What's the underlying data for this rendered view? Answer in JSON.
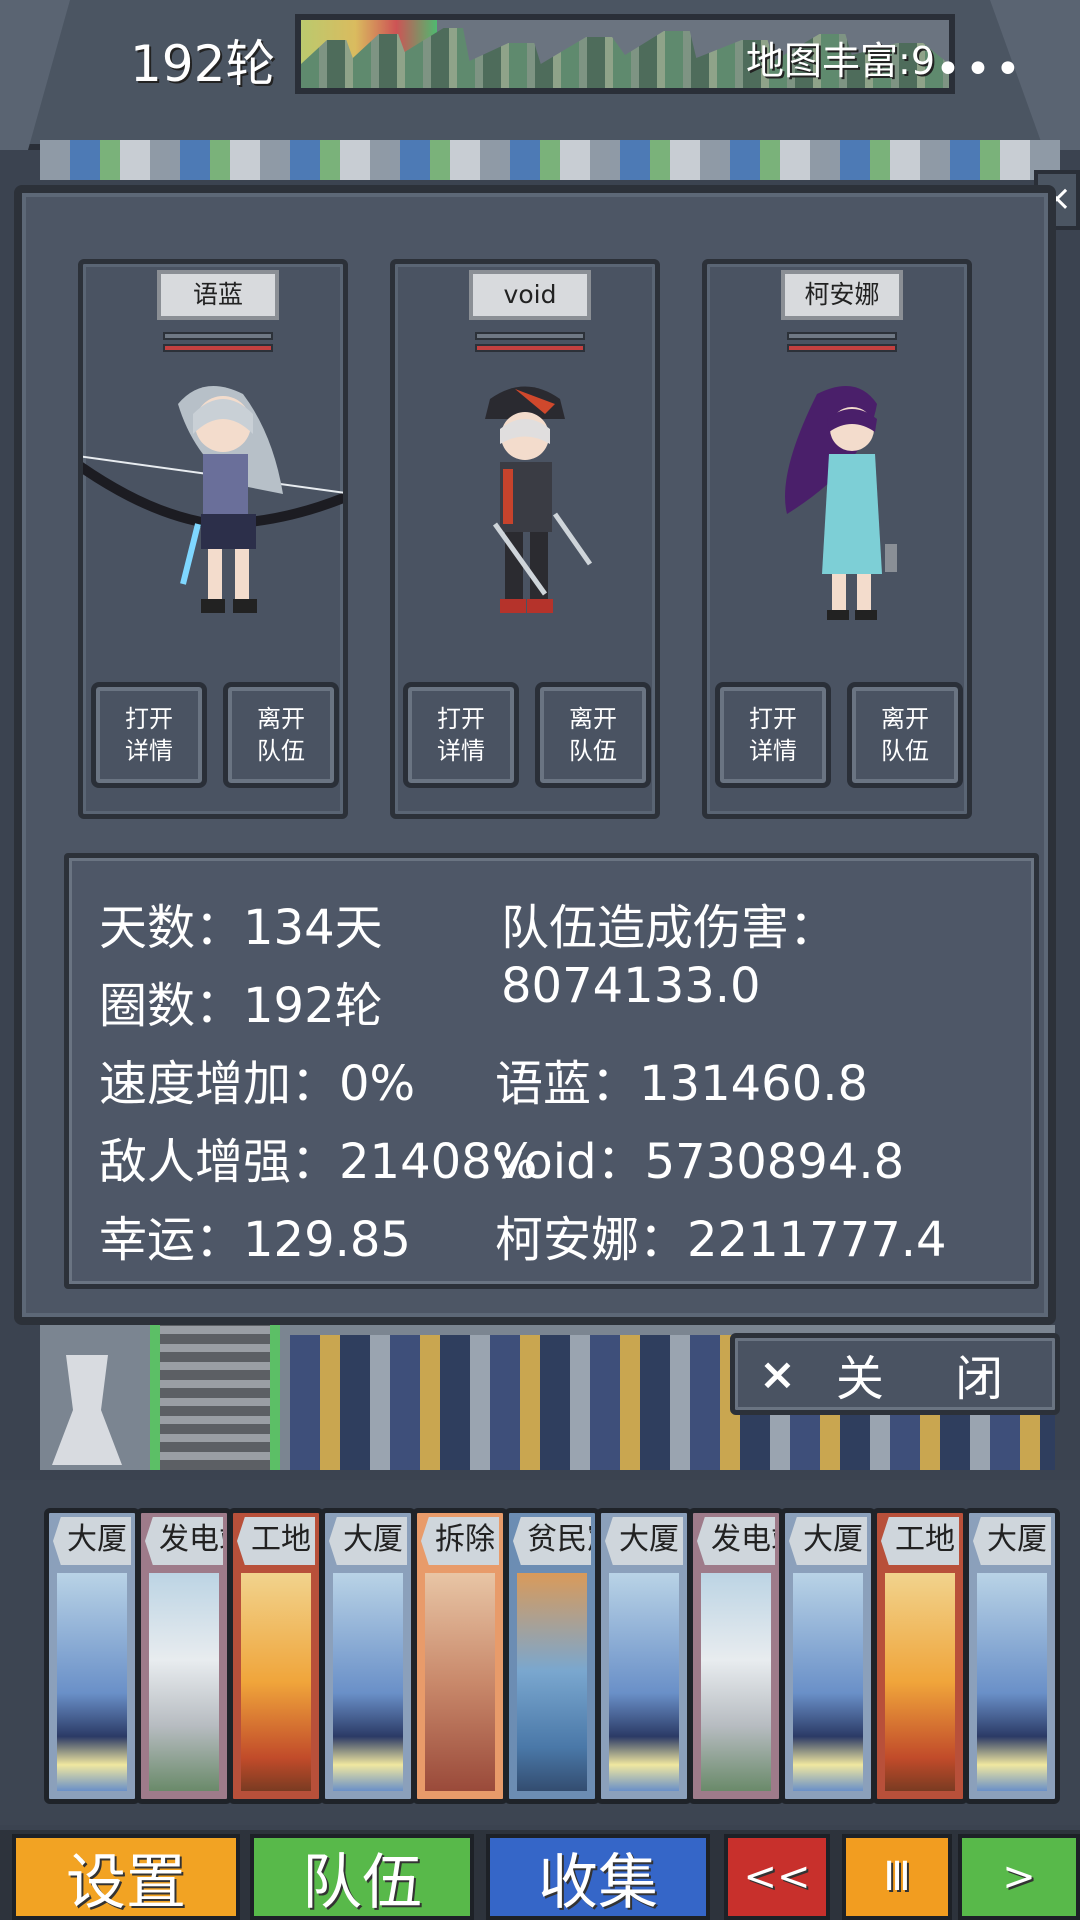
{
  "top": {
    "round": "192轮",
    "map_richness_label": "地图丰富:9",
    "map_richness_progress": 0.21,
    "more": "•••"
  },
  "team": {
    "members": [
      {
        "name": "语蓝",
        "details": "打开\n详情",
        "leave": "离开\n队伍"
      },
      {
        "name": "void",
        "details": "打开\n详情",
        "leave": "离开\n队伍"
      },
      {
        "name": "柯安娜",
        "details": "打开\n详情",
        "leave": "离开\n队伍"
      }
    ],
    "stats": {
      "days": "天数：134天",
      "rounds": "圈数：192轮",
      "speed": "速度增加：0%",
      "enemy": "敌人增强：21408%",
      "luck": "幸运：129.85",
      "damage_title": "队伍造成伤害：",
      "damage_total": "8074133.0",
      "dmg_member1": "语蓝：131460.8",
      "dmg_member2": "void：5730894.8",
      "dmg_member3": "柯安娜：2211777.4"
    },
    "close_label": "关 闭",
    "close_icon": "×"
  },
  "side_close": "×",
  "hand": [
    {
      "label": "大厦",
      "kind": "tall"
    },
    {
      "label": "发电站",
      "kind": "power"
    },
    {
      "label": "工地",
      "kind": "site"
    },
    {
      "label": "大厦",
      "kind": "tall"
    },
    {
      "label": "拆除",
      "kind": "demolish"
    },
    {
      "label": "贫民窟",
      "kind": "slum"
    },
    {
      "label": "大厦",
      "kind": "tall"
    },
    {
      "label": "发电站",
      "kind": "power"
    },
    {
      "label": "大厦",
      "kind": "tall"
    },
    {
      "label": "工地",
      "kind": "site"
    },
    {
      "label": "大厦",
      "kind": "tall"
    }
  ],
  "menu": {
    "settings": "设置",
    "team": "队伍",
    "collect": "收集",
    "back_icon": "<<",
    "pause_icon": "Ⅲ",
    "next_icon": ">"
  }
}
